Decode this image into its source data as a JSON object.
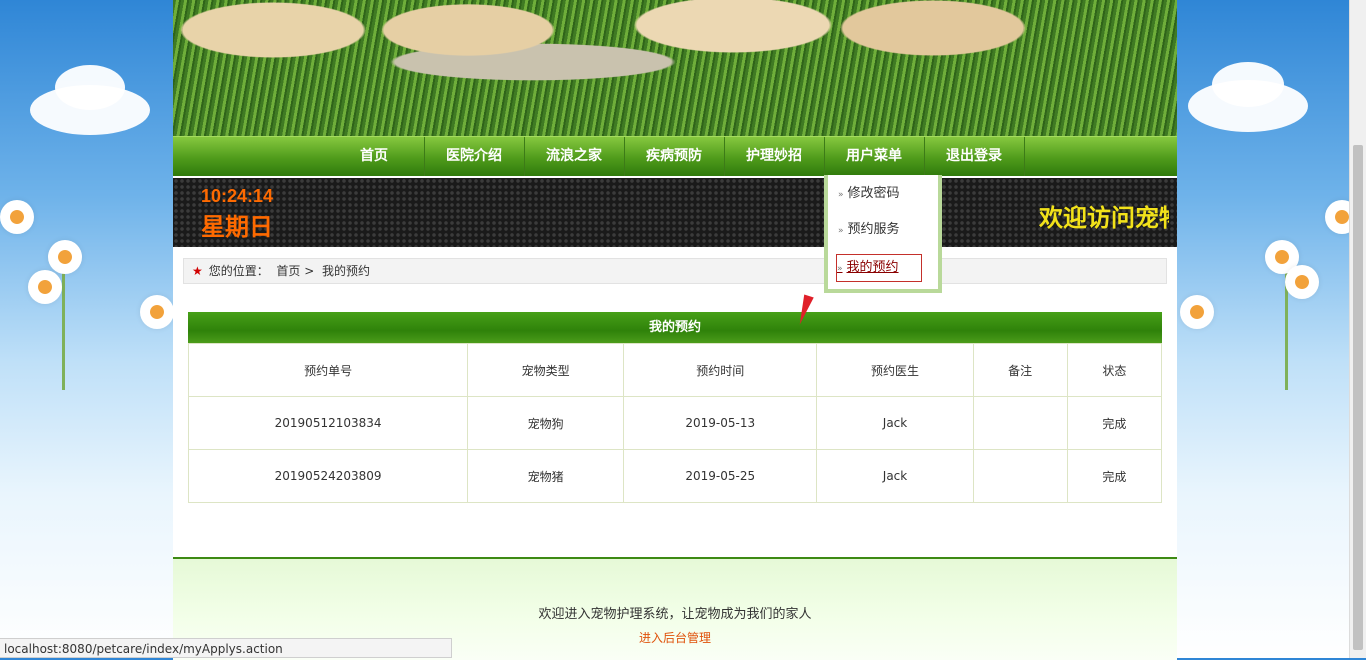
{
  "nav": {
    "items": [
      {
        "label": "首页"
      },
      {
        "label": "医院介绍"
      },
      {
        "label": "流浪之家"
      },
      {
        "label": "疾病预防"
      },
      {
        "label": "护理妙招"
      },
      {
        "label": "用户菜单"
      },
      {
        "label": "退出登录"
      }
    ]
  },
  "ticker": {
    "time": "10:24:14",
    "day": "星期日",
    "marquee": "欢迎访问宠物"
  },
  "dropdown": {
    "items": [
      {
        "label": "修改密码"
      },
      {
        "label": "预约服务"
      },
      {
        "label": "我的预约"
      }
    ]
  },
  "breadcrumb": {
    "prefix": "您的位置：",
    "home": "首页",
    "separator": ">",
    "current": "我的预约"
  },
  "panel": {
    "title": "我的预约",
    "columns": [
      "预约单号",
      "宠物类型",
      "预约时间",
      "预约医生",
      "备注",
      "状态"
    ],
    "rows": [
      [
        "20190512103834",
        "宠物狗",
        "2019-05-13",
        "Jack",
        "",
        "完成"
      ],
      [
        "20190524203809",
        "宠物猪",
        "2019-05-25",
        "Jack",
        "",
        "完成"
      ]
    ]
  },
  "footer": {
    "welcome": "欢迎进入宠物护理系统，让宠物成为我们的家人",
    "admin_link": "进入后台管理"
  },
  "status_bar": {
    "url": "localhost:8080/petcare/index/myApplys.action"
  },
  "colors": {
    "nav_green": "#4f9b1b",
    "clock_orange": "#ff6a00",
    "marquee_yellow": "#f2e21a",
    "footer_link": "#e0520b",
    "breadcrumb_star": "#d10000"
  }
}
